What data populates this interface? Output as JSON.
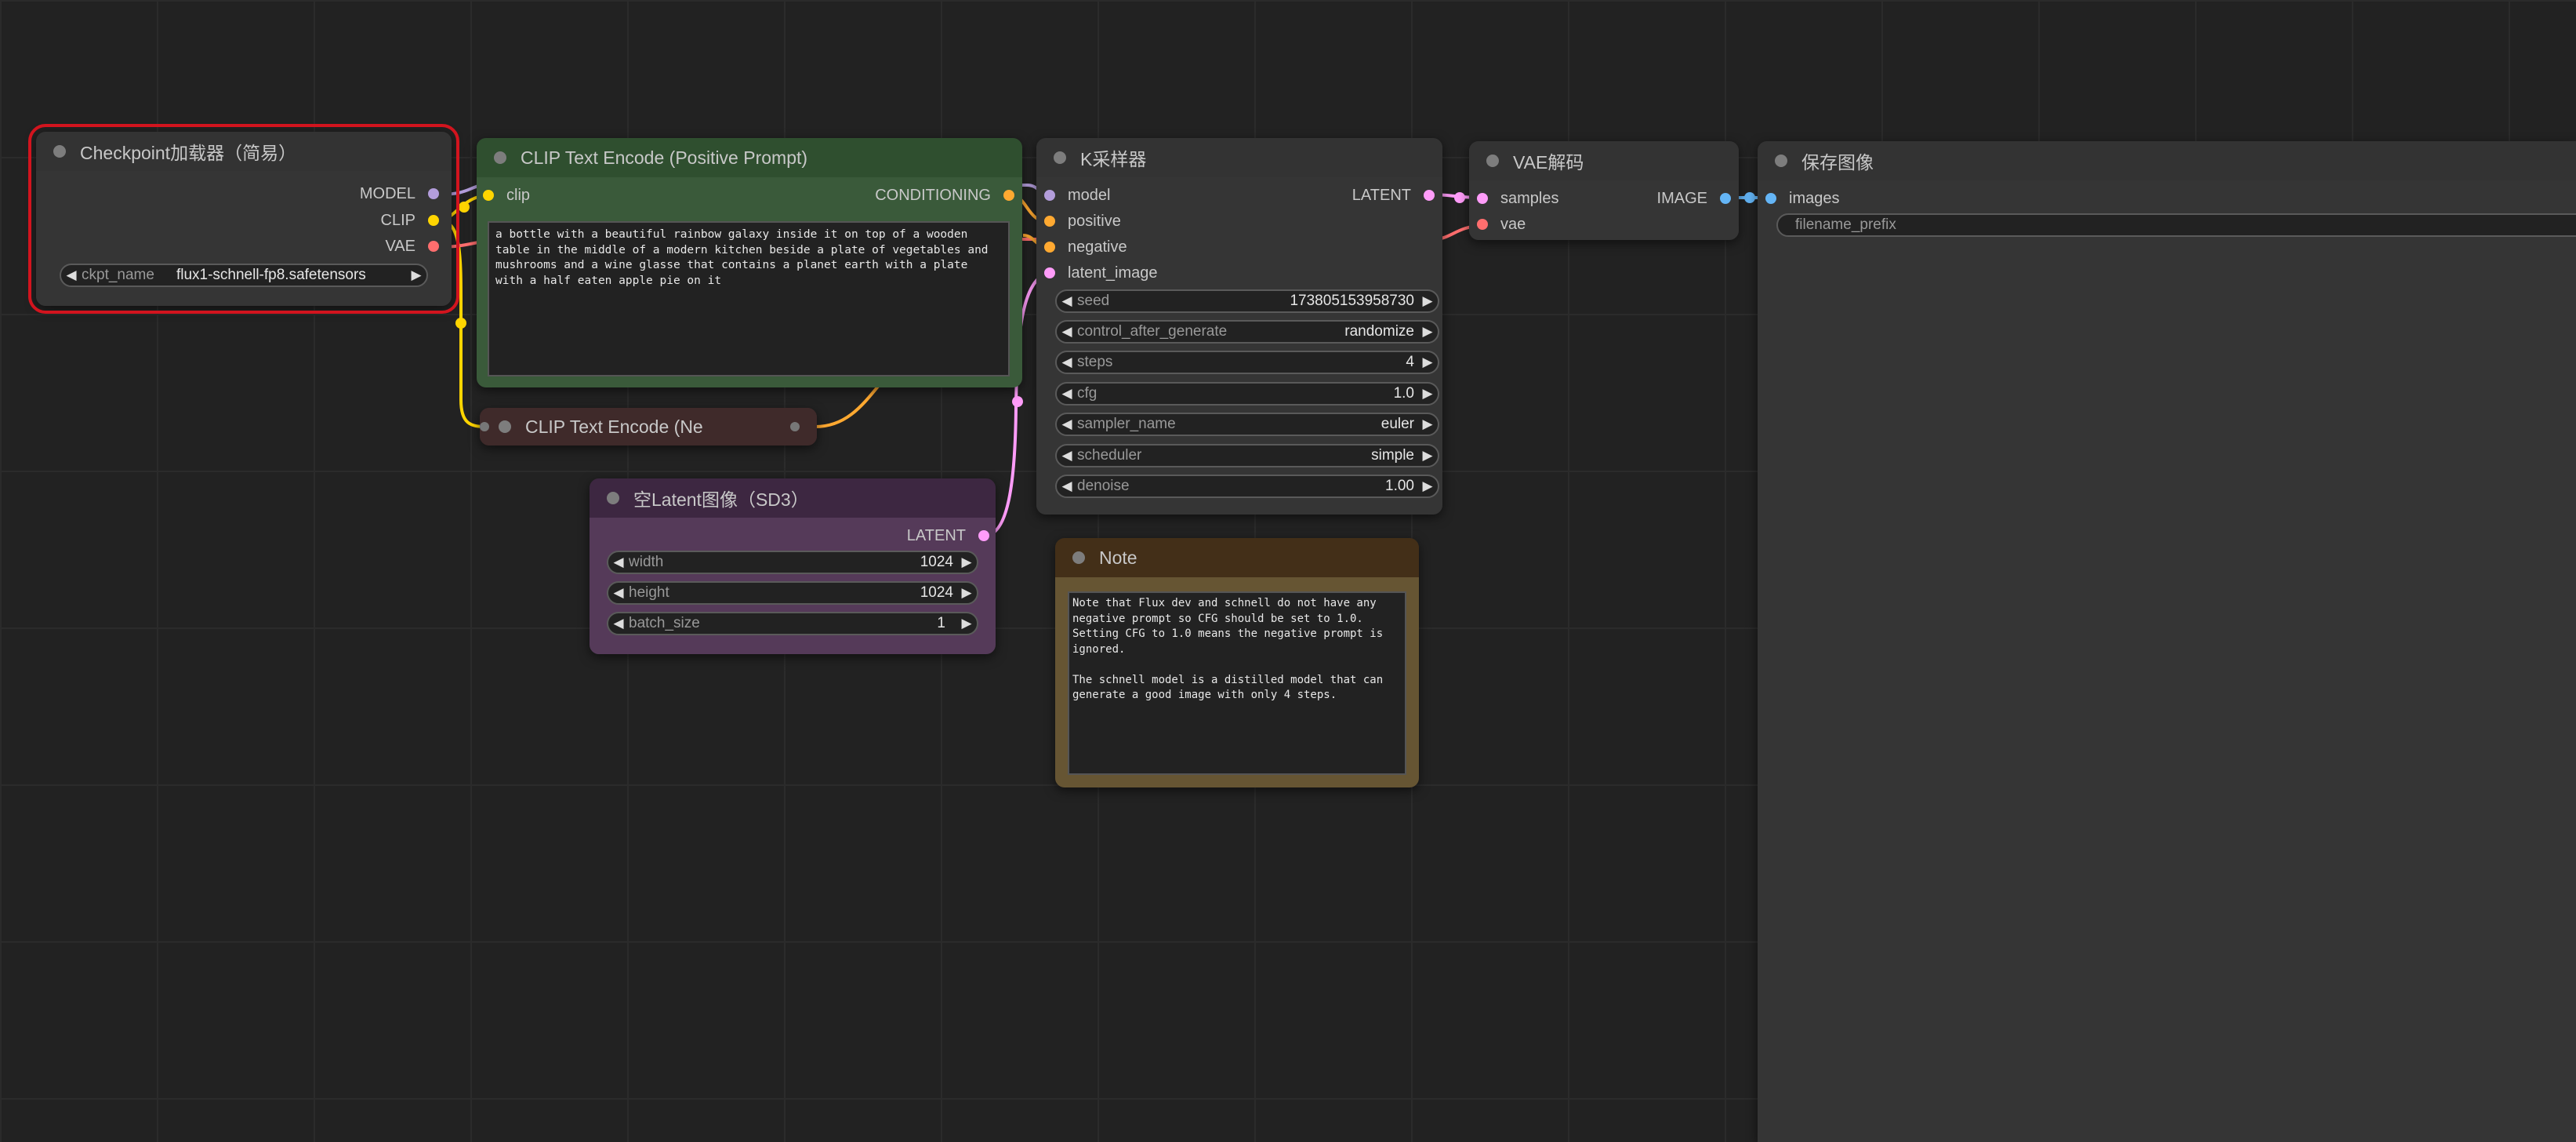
{
  "colors": {
    "background": "#222222",
    "grid": "#2b2b2b",
    "selection_outline": "#d2141e",
    "model_pin": "#b39ddb",
    "clip_pin": "#ffd500",
    "vae_pin": "#ff6e6e",
    "conditioning_pin": "#ffa931",
    "latent_pin": "#ff9cf9",
    "image_pin": "#64b5f6",
    "neutral_pin": "#777777"
  },
  "nodes": {
    "checkpoint_loader": {
      "title": "Checkpoint加载器（简易）",
      "outputs": [
        "MODEL",
        "CLIP",
        "VAE"
      ],
      "widget": {
        "label": "ckpt_name",
        "value": "flux1-schnell-fp8.safetensors"
      }
    },
    "clip_positive": {
      "title": "CLIP Text Encode (Positive Prompt)",
      "input": "clip",
      "output": "CONDITIONING",
      "text": "a bottle with a beautiful rainbow galaxy inside it on top of a wooden\ntable in the middle of a modern kitchen beside a plate of vegetables and\nmushrooms and a wine glasse that contains a planet earth with a plate\nwith a half eaten apple pie on it"
    },
    "clip_negative": {
      "title": "CLIP Text Encode (Ne"
    },
    "empty_latent": {
      "title": "空Latent图像（SD3）",
      "output": "LATENT",
      "widgets": [
        {
          "label": "width",
          "value": "1024"
        },
        {
          "label": "height",
          "value": "1024"
        },
        {
          "label": "batch_size",
          "value": "1"
        }
      ]
    },
    "ksampler": {
      "title": "K采样器",
      "inputs": [
        "model",
        "positive",
        "negative",
        "latent_image"
      ],
      "output": "LATENT",
      "widgets": [
        {
          "label": "seed",
          "value": "173805153958730"
        },
        {
          "label": "control_after_generate",
          "value": "randomize"
        },
        {
          "label": "steps",
          "value": "4"
        },
        {
          "label": "cfg",
          "value": "1.0"
        },
        {
          "label": "sampler_name",
          "value": "euler"
        },
        {
          "label": "scheduler",
          "value": "simple"
        },
        {
          "label": "denoise",
          "value": "1.00"
        }
      ]
    },
    "note": {
      "title": "Note",
      "text": "Note that Flux dev and schnell do not have any\nnegative prompt so CFG should be set to 1.0.\nSetting CFG to 1.0 means the negative prompt is\nignored.\n\nThe schnell model is a distilled model that can\ngenerate a good image with only 4 steps."
    },
    "vae_decode": {
      "title": "VAE解码",
      "inputs": [
        "samples",
        "vae"
      ],
      "output": "IMAGE"
    },
    "save_image": {
      "title": "保存图像",
      "input": "images",
      "widget": {
        "label": "filename_prefix"
      }
    }
  }
}
